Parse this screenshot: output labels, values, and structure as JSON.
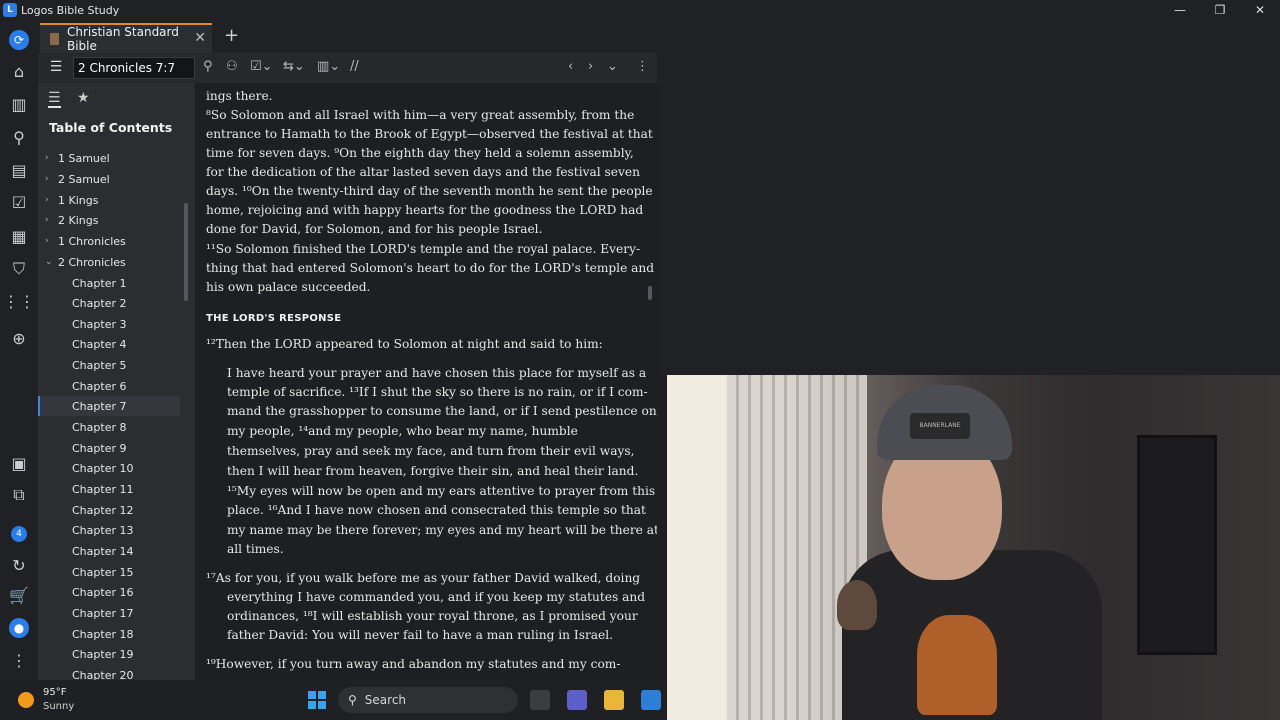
{
  "window": {
    "title": "Logos Bible Study",
    "controls": [
      "—",
      "❐",
      "✕"
    ]
  },
  "tab": {
    "label": "Christian Standard Bible",
    "close": "✕",
    "add": "+"
  },
  "toolbar": {
    "reference": "2 Chronicles 7:7"
  },
  "sidebar": {
    "title": "Table of Contents",
    "books": [
      {
        "label": "1 Samuel",
        "chev": "›"
      },
      {
        "label": "2 Samuel",
        "chev": "›"
      },
      {
        "label": "1 Kings",
        "chev": "›"
      },
      {
        "label": "2 Kings",
        "chev": "›"
      },
      {
        "label": "1 Chronicles",
        "chev": "›"
      },
      {
        "label": "2 Chronicles",
        "chev": "⌄"
      }
    ],
    "chapters": [
      "Chapter 1",
      "Chapter 2",
      "Chapter 3",
      "Chapter 4",
      "Chapter 5",
      "Chapter 6",
      "Chapter 7",
      "Chapter 8",
      "Chapter 9",
      "Chapter 10",
      "Chapter 11",
      "Chapter 12",
      "Chapter 13",
      "Chapter 14",
      "Chapter 15",
      "Chapter 16",
      "Chapter 17",
      "Chapter 18",
      "Chapter 19",
      "Chapter 20"
    ],
    "selected_chapter": "Chapter 7"
  },
  "reader": {
    "lines": [
      "ings there.",
      "⁸So Solomon and all Israel with him—a very great assembly, from the",
      "entrance to Hamath to the Brook of Egypt—observed the festival at that",
      "time for seven days. ⁹On the eighth day they held a solemn assembly,",
      "for the dedication of the altar lasted seven days and the festival seven",
      "days. ¹⁰On the twenty-third day of the seventh month he sent the people",
      "home, rejoicing and with happy hearts for the goodness the LORD had",
      "done for David, for Solomon, and for his people Israel.",
      "¹¹So Solomon finished the LORD's temple and the royal palace. Every-",
      "thing that had entered Solomon's heart to do for the LORD's temple and for",
      "his own palace succeeded."
    ],
    "heading": "THE LORD'S RESPONSE",
    "line12": "¹²Then the LORD appeared to Solomon at night and said to him:",
    "poem": [
      "I have heard your prayer and have chosen this place for myself as a",
      "temple of sacrifice. ¹³If I shut the sky so there is no rain, or if I com-",
      "mand the grasshopper to consume the land, or if I send pestilence on",
      "my people, ¹⁴and my people, who bear my name, humble",
      "themselves, pray and seek my face, and turn from their evil ways,",
      "then I will hear from heaven, forgive their sin, and heal their land.",
      "¹⁵My eyes will now be open and my ears attentive to prayer from this",
      "place. ¹⁶And I have now chosen and consecrated this temple so that",
      "my name may be there forever; my eyes and my heart will be there at",
      "all times."
    ],
    "poem2": [
      "¹⁷As for you, if you walk before me as your father David walked, doing",
      "everything I have commanded you, and if you keep my statutes and",
      "ordinances, ¹⁸I will establish your royal throne, as I promised your",
      "father David: You will never fail to have a man ruling in Israel.",
      "¹⁹However, if you turn away and abandon my statutes and my com-"
    ]
  },
  "cap": {
    "logo_text": "BANNERLANE"
  },
  "taskbar": {
    "temp": "95°F",
    "condition": "Sunny",
    "search_label": "Search"
  },
  "rail": {
    "badge": "4"
  },
  "colors": {
    "accent": "#2b7de9",
    "tab_accent": "#e08a2c"
  }
}
